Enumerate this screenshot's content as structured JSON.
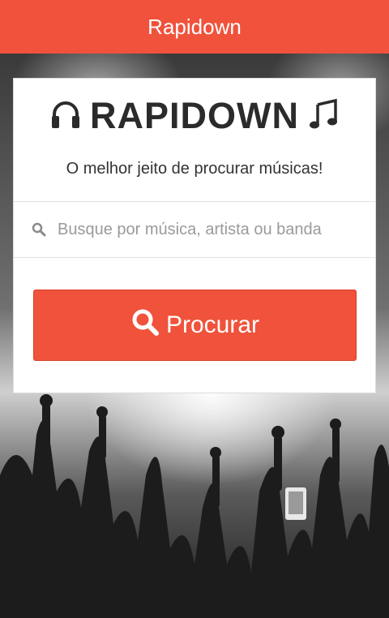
{
  "topbar": {
    "title": "Rapidown"
  },
  "brand": {
    "title": "RAPIDOWN",
    "tagline": "O melhor jeito de procurar músicas!",
    "left_icon": "headphones-icon",
    "right_icon": "music-note-icon"
  },
  "search": {
    "placeholder": "Busque por música, artista ou banda",
    "value": "",
    "icon": "search-icon"
  },
  "submit": {
    "label": "Procurar",
    "icon": "search-icon"
  },
  "colors": {
    "accent": "#f0523b",
    "card": "#ffffff",
    "text_dark": "#2b2b2b",
    "placeholder": "#9a9a9a"
  }
}
